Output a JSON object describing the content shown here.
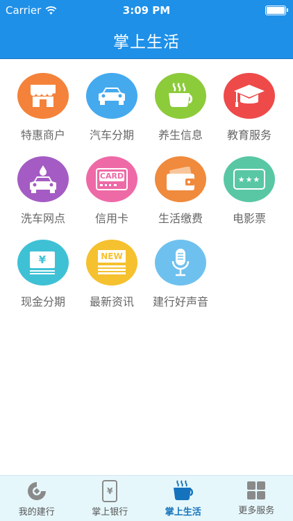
{
  "status": {
    "carrier": "Carrier",
    "time": "3:09 PM"
  },
  "header": {
    "title": "掌上生活"
  },
  "grid": [
    {
      "label": "特惠商户",
      "icon": "storefront-icon",
      "color": "#f4823a"
    },
    {
      "label": "汽车分期",
      "icon": "car-icon",
      "color": "#45a9ee"
    },
    {
      "label": "养生信息",
      "icon": "tea-cup-icon",
      "color": "#8ccb3a"
    },
    {
      "label": "教育服务",
      "icon": "graduation-cap-icon",
      "color": "#ee4a4a"
    },
    {
      "label": "洗车网点",
      "icon": "car-wash-icon",
      "color": "#a45cc4"
    },
    {
      "label": "信用卡",
      "icon": "credit-card-icon",
      "color": "#ee6aa7",
      "badge": "CARD"
    },
    {
      "label": "生活缴费",
      "icon": "wallet-icon",
      "color": "#f08a3c"
    },
    {
      "label": "电影票",
      "icon": "movie-ticket-icon",
      "color": "#59c7a4",
      "badge": "★★★"
    },
    {
      "label": "现金分期",
      "icon": "cash-icon",
      "color": "#3fc1d5",
      "badge": "¥"
    },
    {
      "label": "最新资讯",
      "icon": "news-icon",
      "color": "#f5c12e",
      "badge": "NEW"
    },
    {
      "label": "建行好声音",
      "icon": "microphone-icon",
      "color": "#6ec1ee"
    }
  ],
  "tabs": [
    {
      "label": "我的建行",
      "icon": "ccb-logo-icon"
    },
    {
      "label": "掌上银行",
      "icon": "mobile-bank-icon",
      "badge": "¥"
    },
    {
      "label": "掌上生活",
      "icon": "coffee-cup-icon",
      "active": true
    },
    {
      "label": "更多服务",
      "icon": "more-grid-icon"
    }
  ]
}
